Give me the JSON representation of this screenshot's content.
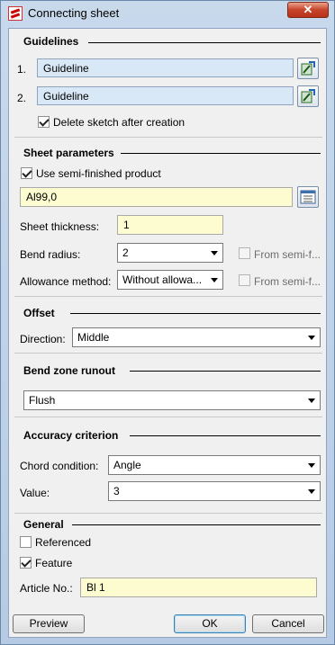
{
  "window": {
    "title": "Connecting sheet",
    "close_glyph": "✕"
  },
  "guidelines": {
    "title": "Guidelines",
    "rows": [
      {
        "num": "1.",
        "value": "Guideline"
      },
      {
        "num": "2.",
        "value": "Guideline"
      }
    ],
    "delete_sketch_label": "Delete sketch after creation",
    "delete_sketch_checked": true
  },
  "sheet": {
    "title": "Sheet parameters",
    "semi_finished_label": "Use semi-finished product",
    "semi_finished_checked": true,
    "material_value": "Al99,0",
    "thickness_label": "Sheet thickness:",
    "thickness_value": "1",
    "bend_radius_label": "Bend radius:",
    "bend_radius_value": "2",
    "from_semi_label_1": "From semi-f...",
    "allowance_label": "Allowance method:",
    "allowance_value": "Without allowa...",
    "from_semi_label_2": "From semi-f..."
  },
  "offset": {
    "title": "Offset",
    "direction_label": "Direction:",
    "direction_value": "Middle"
  },
  "bend_zone": {
    "title": "Bend zone runout",
    "value": "Flush"
  },
  "accuracy": {
    "title": "Accuracy criterion",
    "chord_label": "Chord condition:",
    "chord_value": "Angle",
    "value_label": "Value:",
    "value_value": "3"
  },
  "general": {
    "title": "General",
    "referenced_label": "Referenced",
    "referenced_checked": false,
    "feature_label": "Feature",
    "feature_checked": true,
    "article_label": "Article No.:",
    "article_value": "Bl 1"
  },
  "buttons": {
    "preview": "Preview",
    "ok": "OK",
    "cancel": "Cancel"
  }
}
